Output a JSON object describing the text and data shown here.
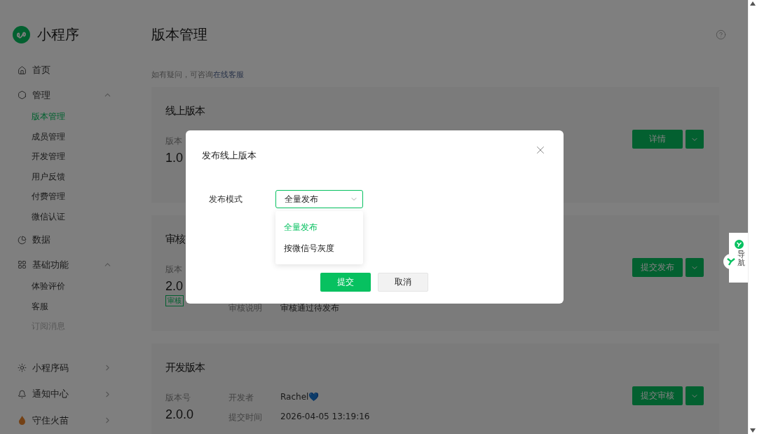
{
  "sidebar": {
    "brand": "小程序",
    "items": [
      {
        "label": "首页"
      },
      {
        "label": "管理",
        "expanded": true,
        "children": [
          {
            "label": "版本管理",
            "selected": true,
            "disabled": false
          },
          {
            "label": "成员管理",
            "selected": false,
            "disabled": false
          },
          {
            "label": "开发管理",
            "selected": false,
            "disabled": false
          },
          {
            "label": "用户反馈",
            "selected": false,
            "disabled": false
          },
          {
            "label": "付费管理",
            "selected": false,
            "disabled": false
          },
          {
            "label": "微信认证",
            "selected": false,
            "disabled": false
          }
        ]
      },
      {
        "label": "数据"
      },
      {
        "label": "基础功能",
        "expanded": true,
        "children": [
          {
            "label": "体验评价",
            "selected": false,
            "disabled": false
          },
          {
            "label": "客服",
            "selected": false,
            "disabled": false
          },
          {
            "label": "订阅消息",
            "selected": false,
            "disabled": true
          }
        ]
      }
    ],
    "bottom_items": [
      {
        "label": "小程序码",
        "expanded": false
      },
      {
        "label": "通知中心",
        "expanded": false
      },
      {
        "label": "守住火苗",
        "expanded": false
      }
    ]
  },
  "page": {
    "title": "版本管理",
    "notice": "如有疑问，可咨询",
    "notice_link": "在线客服"
  },
  "cards": [
    {
      "title": "线上版本",
      "version_label": "版本",
      "version": "1.0",
      "button": "详情"
    },
    {
      "title": "审核",
      "version_label": "版本",
      "version": "2.0",
      "tag": "审核",
      "meta": [
        {
          "label": "审核说明",
          "value": "审核通过待发布"
        }
      ],
      "button": "提交发布"
    },
    {
      "title": "开发版本",
      "version_label": "版本号",
      "version": "2.0.0",
      "meta": [
        {
          "label": "开发者",
          "value": "Rachel💙"
        },
        {
          "label": "提交时间",
          "value": "2026-04-05 13:19:16"
        }
      ],
      "button": "提交审核"
    }
  ],
  "dialog": {
    "title": "发布线上版本",
    "field_label": "发布模式",
    "select_value": "全量发布",
    "options": [
      {
        "label": "全量发布",
        "selected": true
      },
      {
        "label": "按微信号灰度",
        "selected": false
      }
    ],
    "buttons": [
      {
        "label": "提交",
        "kind": "primary"
      },
      {
        "label": "取消",
        "kind": "secondary"
      }
    ]
  },
  "nav_widget": {
    "label": "导航"
  }
}
